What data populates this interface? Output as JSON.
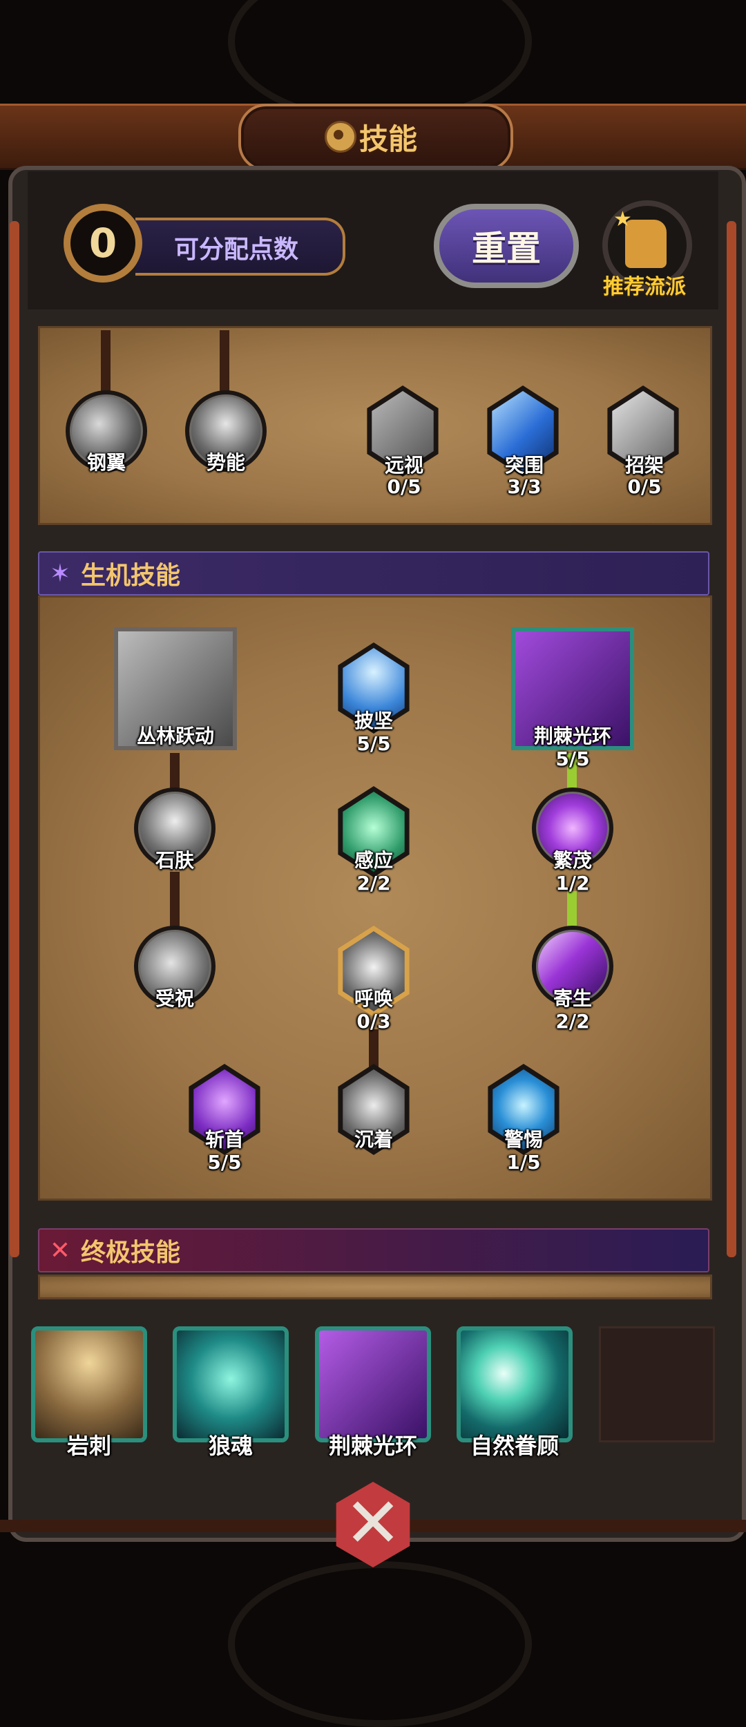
{
  "header": {
    "title": "技能",
    "title_icon": "gear-wheel-icon"
  },
  "points": {
    "value": "0",
    "label": "可分配点数"
  },
  "reset_button": {
    "label": "重置"
  },
  "recommend": {
    "label": "推荐流派",
    "icon": "thumbs-up-icon"
  },
  "upper_skills": [
    {
      "name": "钢翼",
      "count": ""
    },
    {
      "name": "势能",
      "count": ""
    },
    {
      "name": "远视",
      "count": "0/5"
    },
    {
      "name": "突围",
      "count": "3/3"
    },
    {
      "name": "招架",
      "count": "0/5"
    }
  ],
  "life_section": {
    "title": "生机技能",
    "skills": {
      "jungle": {
        "name": "丛林跃动",
        "count": ""
      },
      "pijian": {
        "name": "披坚",
        "count": "5/5"
      },
      "thorn": {
        "name": "荆棘光环",
        "count": "5/5"
      },
      "stone": {
        "name": "石肤",
        "count": ""
      },
      "sense": {
        "name": "感应",
        "count": "2/2"
      },
      "lush": {
        "name": "繁茂",
        "count": "1/2"
      },
      "bless": {
        "name": "受祝",
        "count": ""
      },
      "summon": {
        "name": "呼唤",
        "count": "0/3"
      },
      "parasite": {
        "name": "寄生",
        "count": "2/2"
      },
      "behead": {
        "name": "斩首",
        "count": "5/5"
      },
      "calm": {
        "name": "沉着",
        "count": ""
      },
      "alert": {
        "name": "警惕",
        "count": "1/5"
      }
    }
  },
  "ultimate_section": {
    "title": "终极技能"
  },
  "ultimate_slots": [
    {
      "name": "岩刺"
    },
    {
      "name": "狼魂"
    },
    {
      "name": "荆棘光环"
    },
    {
      "name": "自然眷顾"
    }
  ],
  "colors": {
    "accent_gold": "#f3c66e",
    "section_purple": "#3c2a66",
    "close_red": "#c23b3e",
    "slot_teal": "#2b8f7e"
  }
}
